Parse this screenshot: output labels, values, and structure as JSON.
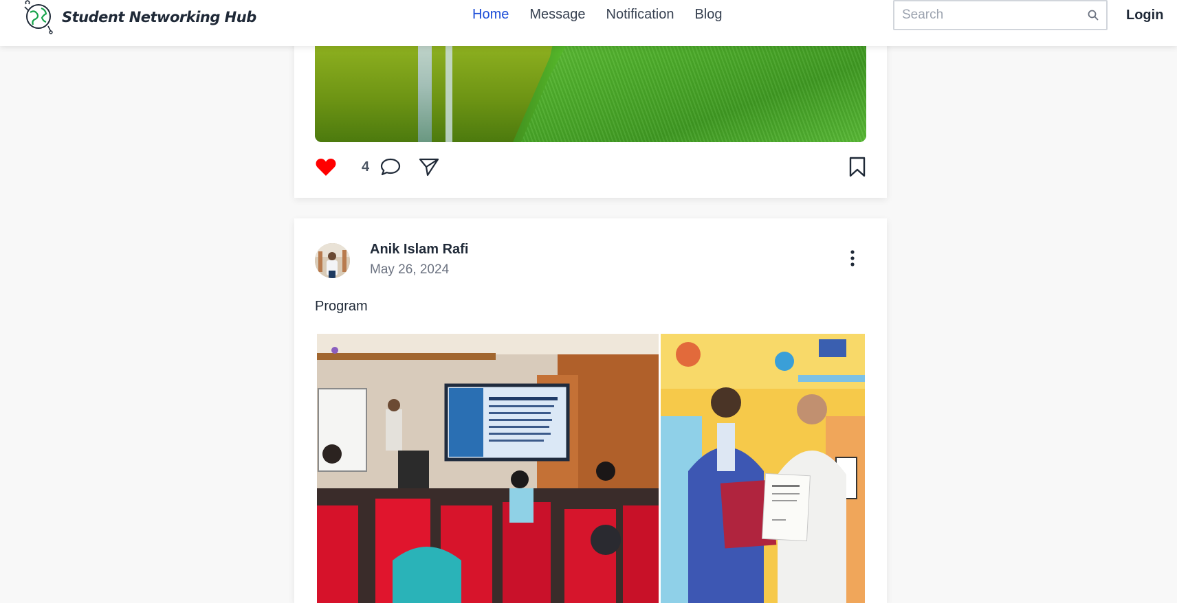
{
  "header": {
    "brand": "Student Networking Hub",
    "nav": [
      {
        "label": "Home",
        "active": true
      },
      {
        "label": "Message",
        "active": false
      },
      {
        "label": "Notification",
        "active": false
      },
      {
        "label": "Blog",
        "active": false
      }
    ],
    "search_placeholder": "Search",
    "login_label": "Login"
  },
  "feed": {
    "post_1": {
      "likes": "4",
      "icons": [
        "heart-icon",
        "comment-icon",
        "share-icon",
        "bookmark-icon"
      ]
    },
    "post_2": {
      "author": "Anik Islam Rafi",
      "date": "May 26, 2024",
      "text": "Program",
      "icons": [
        "more-vertical-icon"
      ]
    }
  },
  "colors": {
    "accent": "#1d4ed8",
    "like": "#ff0000",
    "background": "#f8f8f8"
  }
}
